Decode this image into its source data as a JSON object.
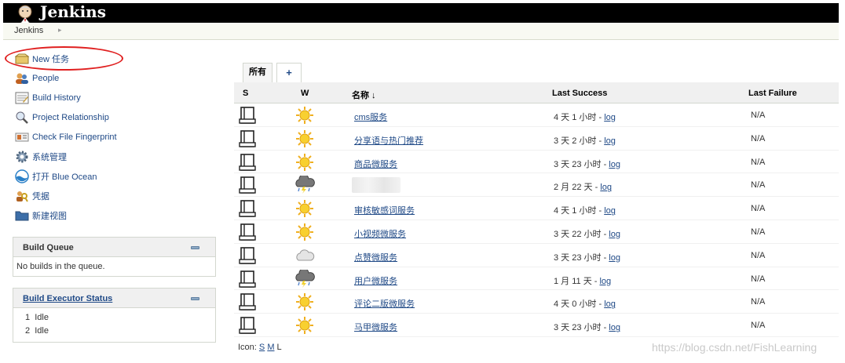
{
  "header": {
    "brand": "Jenkins"
  },
  "breadcrumb": {
    "items": [
      "Jenkins"
    ],
    "separator": "▸"
  },
  "tasks": [
    {
      "label": "New 任务",
      "icon": "new-item-icon"
    },
    {
      "label": "People",
      "icon": "people-icon"
    },
    {
      "label": "Build History",
      "icon": "build-history-icon"
    },
    {
      "label": "Project Relationship",
      "icon": "search-icon"
    },
    {
      "label": "Check File Fingerprint",
      "icon": "fingerprint-icon"
    },
    {
      "label": "系统管理",
      "icon": "gear-icon"
    },
    {
      "label": "打开 Blue Ocean",
      "icon": "blue-ocean-icon"
    },
    {
      "label": "凭据",
      "icon": "credentials-icon"
    },
    {
      "label": "新建视图",
      "icon": "folder-icon"
    }
  ],
  "build_queue": {
    "title": "Build Queue",
    "empty_text": "No builds in the queue."
  },
  "executors": {
    "title": "Build Executor Status",
    "items": [
      {
        "num": "1",
        "state": "Idle"
      },
      {
        "num": "2",
        "state": "Idle"
      }
    ]
  },
  "tabs": {
    "active": "所有",
    "add": "+"
  },
  "table": {
    "headers": {
      "s": "S",
      "w": "W",
      "name": "名称 ↓",
      "last_success": "Last Success",
      "last_failure": "Last Failure"
    },
    "rows": [
      {
        "name": "cms服务",
        "weather": "sunny",
        "success": "4 天 1 小时 - ",
        "failure": "N/A"
      },
      {
        "name": "分享语与热门推荐",
        "weather": "sunny",
        "success": "3 天 2 小时 - ",
        "failure": "N/A"
      },
      {
        "name": "商品微服务",
        "weather": "sunny",
        "success": "3 天 23 小时 - ",
        "failure": "N/A"
      },
      {
        "name": "",
        "weather": "storm",
        "success": "2 月 22 天 - ",
        "failure": "N/A",
        "redacted": true
      },
      {
        "name": "审核敏感词服务",
        "weather": "sunny",
        "success": "4 天 1 小时 - ",
        "failure": "N/A"
      },
      {
        "name": "小视频微服务",
        "weather": "sunny",
        "success": "3 天 22 小时 - ",
        "failure": "N/A"
      },
      {
        "name": "点赞微服务",
        "weather": "cloudy",
        "success": "3 天 23 小时 - ",
        "failure": "N/A"
      },
      {
        "name": "用户微服务",
        "weather": "storm",
        "success": "1 月 11 天 - ",
        "failure": "N/A"
      },
      {
        "name": "评论二版微服务",
        "weather": "sunny",
        "success": "4 天 0 小时 - ",
        "failure": "N/A"
      },
      {
        "name": "马甲微服务",
        "weather": "sunny",
        "success": "3 天 23 小时 - ",
        "failure": "N/A"
      }
    ],
    "log_label": "log"
  },
  "icon_size": {
    "label": "Icon: ",
    "options": [
      "S",
      "M",
      "L"
    ]
  },
  "watermark": "https://blog.csdn.net/FishLearning"
}
